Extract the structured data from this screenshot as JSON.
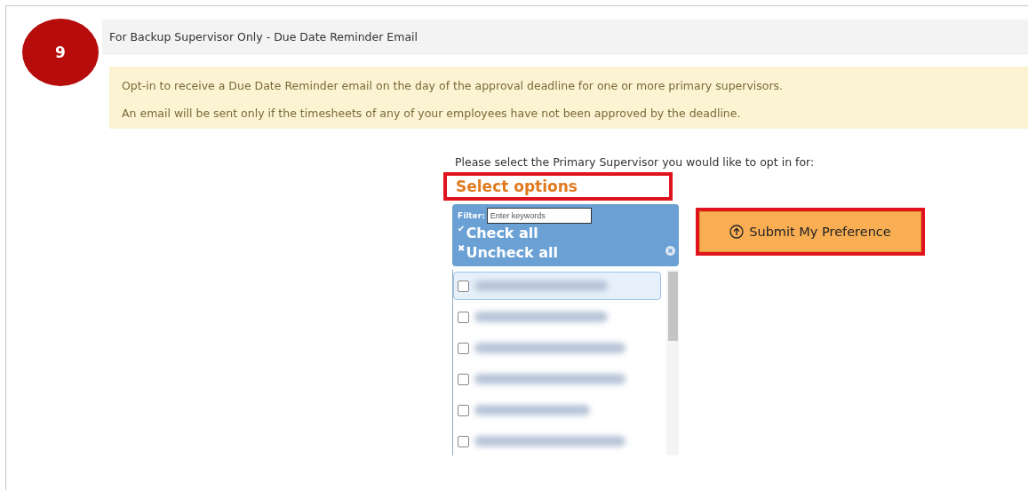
{
  "step_badge": "9",
  "section_title": "For Backup Supervisor Only - Due Date Reminder Email",
  "notice": [
    "Opt-in to receive a Due Date Reminder email on the day of the approval deadline for one or more primary supervisors.",
    "An email will be sent only if the timesheets of any of your employees have not been approved by the deadline."
  ],
  "prompt": "Please select the Primary Supervisor you would like to opt in for:",
  "select": {
    "value": "Select options"
  },
  "filter": {
    "label": "Filter:",
    "placeholder": "Enter keywords"
  },
  "check_all": {
    "icon": "✔",
    "label": "Check all"
  },
  "uncheck_all": {
    "icon": "✖",
    "label": "Uncheck all"
  },
  "options": [
    {
      "checked": false,
      "selected": true
    },
    {
      "checked": false,
      "selected": false
    },
    {
      "checked": false,
      "selected": false
    },
    {
      "checked": false,
      "selected": false
    },
    {
      "checked": false,
      "selected": false
    },
    {
      "checked": false,
      "selected": false
    }
  ],
  "submit_button": "Submit My Preference"
}
